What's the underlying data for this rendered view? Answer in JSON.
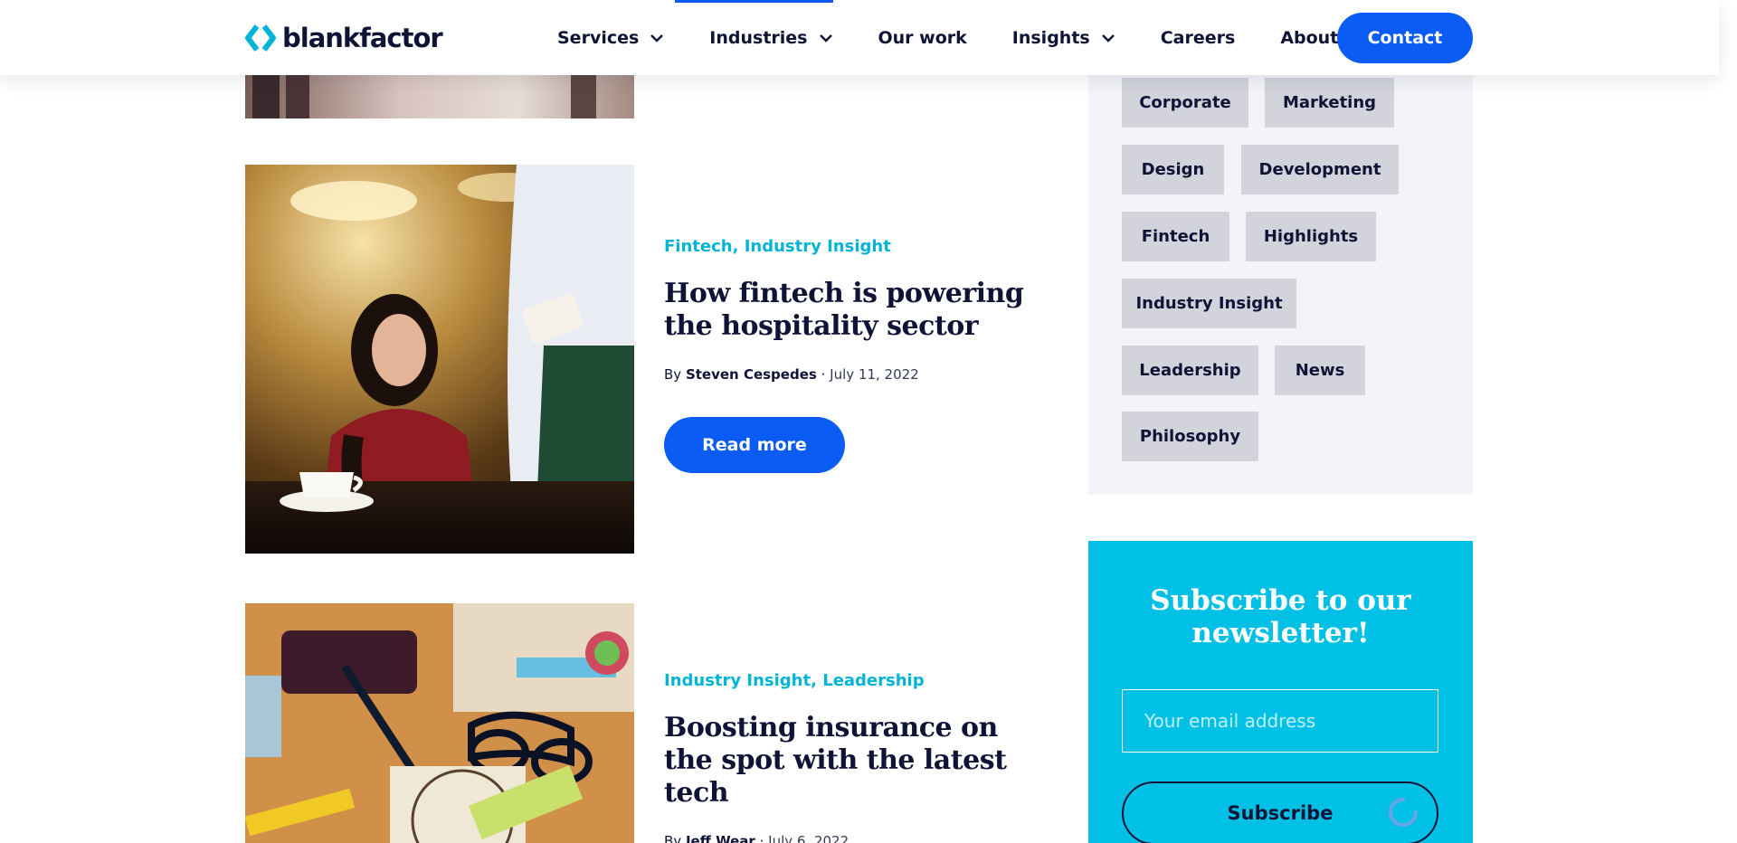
{
  "header": {
    "logo_text": "blankfactor",
    "nav": [
      {
        "label": "Services",
        "has_dropdown": true
      },
      {
        "label": "Industries",
        "has_dropdown": true
      },
      {
        "label": "Our work",
        "has_dropdown": false
      },
      {
        "label": "Insights",
        "has_dropdown": true
      },
      {
        "label": "Careers",
        "has_dropdown": false
      },
      {
        "label": "About",
        "has_dropdown": false
      }
    ],
    "contact_label": "Contact"
  },
  "articles": [
    {
      "categories": [
        "Fintech",
        "Industry Insight"
      ],
      "title": "How fintech is powering the hospitality sector",
      "by": "By",
      "author": "Steven Cespedes",
      "separator": "·",
      "date": "July 11, 2022",
      "read_more_label": "Read more"
    },
    {
      "categories": [
        "Industry Insight",
        "Leadership"
      ],
      "title": "Boosting insurance on the spot with the latest tech",
      "by": "By",
      "author": "Jeff Wear",
      "separator": "·",
      "date": "July 6, 2022"
    }
  ],
  "sidebar": {
    "tags": [
      "Corporate",
      "Marketing",
      "Design",
      "Development",
      "Fintech",
      "Highlights",
      "Industry Insight",
      "Leadership",
      "News",
      "Philosophy"
    ],
    "newsletter": {
      "title": "Subscribe to our newsletter!",
      "email_placeholder": "Your email address",
      "subscribe_label": "Subscribe"
    }
  },
  "colors": {
    "brand_blue": "#0a5cf5",
    "accent_cyan": "#00b4d8",
    "newsletter_bg": "#00c0e6",
    "navy_text": "#0f1437"
  }
}
